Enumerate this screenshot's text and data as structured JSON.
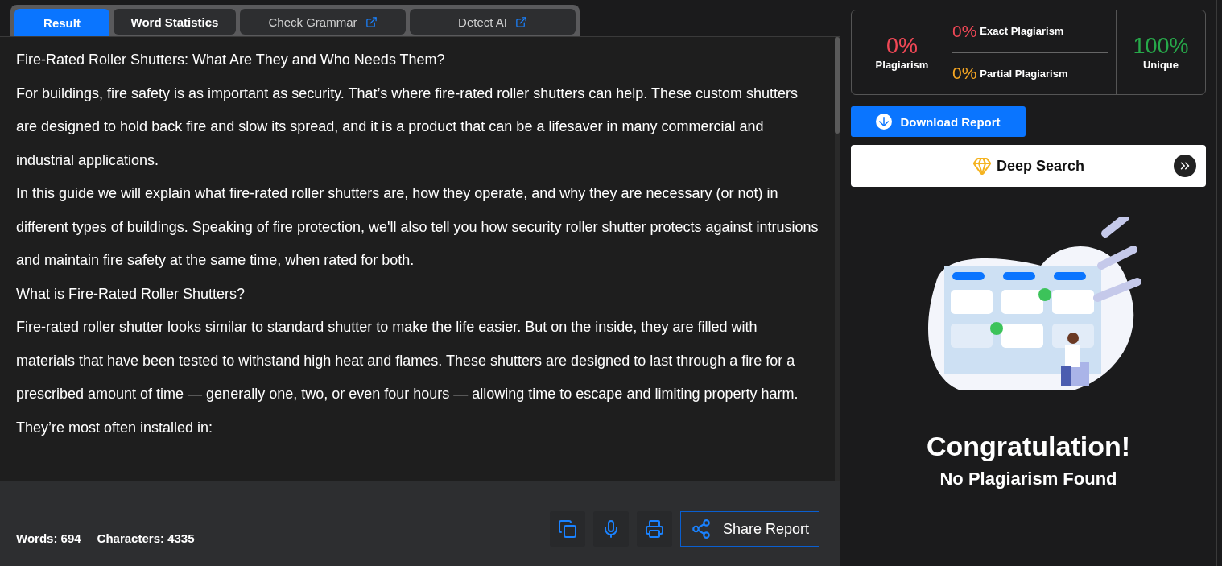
{
  "tabs": [
    {
      "label": "Result",
      "selected": true,
      "external": false
    },
    {
      "label": "Word Statistics",
      "selected": false,
      "external": false
    },
    {
      "label": "Check Grammar",
      "selected": false,
      "external": true
    },
    {
      "label": "Detect AI",
      "selected": false,
      "external": true
    }
  ],
  "paragraphs": [
    "Fire-Rated Roller Shutters: What Are They and Who Needs Them?",
    "For buildings, fire safety is as important as security. That’s where fire-rated roller shutters can help. These custom shutters are designed to hold back fire and slow its spread, and it is a product that can be a lifesaver in many commercial and industrial applications.",
    "In this guide we will explain what fire-rated roller shutters are, how they operate, and why they are necessary (or not) in different types of buildings. Speaking of fire protection, we'll also tell you how security roller shutter protects against intrusions and maintain fire safety at the same time, when rated for both.",
    "What is Fire-Rated Roller Shutters?",
    "Fire-rated roller shutter looks similar to standard shutter to make the life easier. But on the inside, they are filled with materials that have been tested to withstand high heat and flames. These shutters are designed to last through a fire for a prescribed amount of time — generally one, two, or even four hours — allowing time to escape and limiting property harm.",
    "They’re most often installed in:"
  ],
  "footer": {
    "words": "Words: 694",
    "characters": "Characters: 4335",
    "share": "Share Report"
  },
  "summary": {
    "plagiarism": {
      "value": "0%",
      "label": "Plagiarism"
    },
    "exact": {
      "value": "0%",
      "label": "Exact Plagiarism"
    },
    "partial": {
      "value": "0%",
      "label": "Partial Plagiarism"
    },
    "unique": {
      "value": "100%",
      "label": "Unique"
    }
  },
  "download": "Download Report",
  "deep_search": "Deep Search",
  "result": {
    "title": "Congratulation!",
    "subtitle": "No Plagiarism Found"
  }
}
